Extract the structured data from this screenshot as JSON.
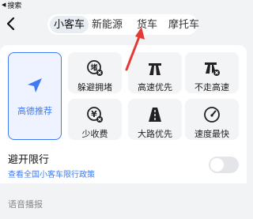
{
  "status_bar": {
    "back_app_label": "搜索"
  },
  "vehicle_tabs": [
    {
      "label": "小客车",
      "active": true
    },
    {
      "label": "新能源",
      "active": false
    },
    {
      "label": "货车",
      "active": false
    },
    {
      "label": "摩托车",
      "active": false
    }
  ],
  "route_options": {
    "featured": {
      "label": "高德推荐",
      "icon": "navigation-arrow-icon"
    },
    "row1": [
      {
        "label": "躲避拥堵",
        "icon": "avoid-congestion-icon"
      },
      {
        "label": "高速优先",
        "icon": "highway-priority-icon"
      },
      {
        "label": "不走高速",
        "icon": "avoid-highway-icon"
      }
    ],
    "row2": [
      {
        "label": "少收费",
        "icon": "less-toll-icon"
      },
      {
        "label": "大路优先",
        "icon": "main-road-icon"
      },
      {
        "label": "速度最快",
        "icon": "fastest-speedometer-icon"
      }
    ]
  },
  "restriction": {
    "title": "避开限行",
    "link": "查看全国小客车限行政策",
    "toggle_on": false
  },
  "voice_section": {
    "label": "语音播报"
  },
  "colors": {
    "accent": "#3d7bf5",
    "annotation": "#e53935"
  }
}
